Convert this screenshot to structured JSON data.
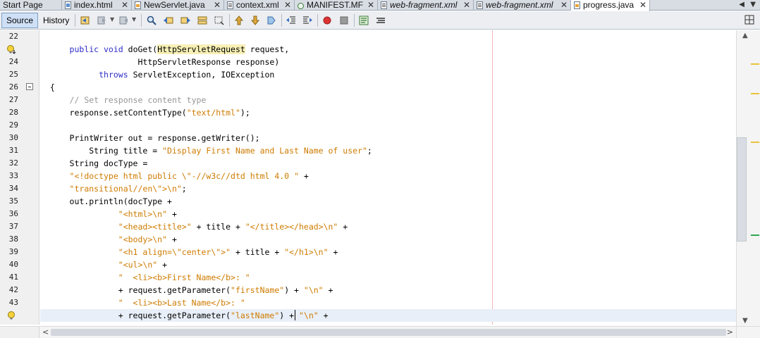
{
  "tabs": [
    {
      "label": "Start Page",
      "icon": "start-page-icon",
      "italic": false,
      "active": false,
      "closable": false
    },
    {
      "label": "index.html",
      "icon": "html-file-icon",
      "italic": false,
      "active": false,
      "closable": true
    },
    {
      "label": "NewServlet.java",
      "icon": "java-file-icon",
      "italic": false,
      "active": false,
      "closable": true
    },
    {
      "label": "context.xml",
      "icon": "xml-file-icon",
      "italic": false,
      "active": false,
      "closable": true
    },
    {
      "label": "MANIFEST.MF",
      "icon": "manifest-file-icon",
      "italic": false,
      "active": false,
      "closable": true
    },
    {
      "label": "web-fragment.xml",
      "icon": "xml-file-icon",
      "italic": true,
      "active": false,
      "closable": true
    },
    {
      "label": "web-fragment.xml",
      "icon": "xml-file-icon",
      "italic": true,
      "active": false,
      "closable": true
    },
    {
      "label": "progress.java",
      "icon": "java-file-icon",
      "italic": false,
      "active": true,
      "closable": true
    }
  ],
  "toolbar": {
    "source_label": "Source",
    "history_label": "History",
    "active_mode": "Source"
  },
  "editor": {
    "current_line": 44,
    "lines": [
      {
        "no": 22,
        "tokens": [
          {
            "t": ""
          }
        ]
      },
      {
        "no": 23,
        "tokens": [
          {
            "t": "      "
          },
          {
            "t": "public void",
            "c": "kw"
          },
          {
            "t": " doGet("
          },
          {
            "t": "HttpServletRequest",
            "c": "hl"
          },
          {
            "t": " request,"
          }
        ]
      },
      {
        "no": 24,
        "tokens": [
          {
            "t": "                    HttpServletResponse response)"
          }
        ]
      },
      {
        "no": 25,
        "tokens": [
          {
            "t": "            "
          },
          {
            "t": "throws",
            "c": "kw"
          },
          {
            "t": " ServletException, IOException"
          }
        ]
      },
      {
        "no": 26,
        "tokens": [
          {
            "t": "  {"
          }
        ]
      },
      {
        "no": 27,
        "tokens": [
          {
            "t": "      "
          },
          {
            "t": "// Set response content type",
            "c": "cmt"
          }
        ]
      },
      {
        "no": 28,
        "tokens": [
          {
            "t": "      response.setContentType("
          },
          {
            "t": "\"text/html\"",
            "c": "str"
          },
          {
            "t": ");"
          }
        ]
      },
      {
        "no": 29,
        "tokens": [
          {
            "t": ""
          }
        ]
      },
      {
        "no": 30,
        "tokens": [
          {
            "t": "      PrintWriter out = response.getWriter();"
          }
        ]
      },
      {
        "no": 31,
        "tokens": [
          {
            "t": "          String title = "
          },
          {
            "t": "\"Display First Name and Last Name of user\"",
            "c": "str"
          },
          {
            "t": ";"
          }
        ]
      },
      {
        "no": 32,
        "tokens": [
          {
            "t": "      String docType ="
          }
        ]
      },
      {
        "no": 33,
        "tokens": [
          {
            "t": "      "
          },
          {
            "t": "\"<!doctype html public \\\"-//w3c//dtd html 4.0 \"",
            "c": "str"
          },
          {
            "t": " +"
          }
        ]
      },
      {
        "no": 34,
        "tokens": [
          {
            "t": "      "
          },
          {
            "t": "\"transitional//en\\\">\\n\"",
            "c": "str"
          },
          {
            "t": ";"
          }
        ]
      },
      {
        "no": 35,
        "tokens": [
          {
            "t": "      out.println(docType +"
          }
        ]
      },
      {
        "no": 36,
        "tokens": [
          {
            "t": "                "
          },
          {
            "t": "\"<html>\\n\"",
            "c": "str"
          },
          {
            "t": " +"
          }
        ]
      },
      {
        "no": 37,
        "tokens": [
          {
            "t": "                "
          },
          {
            "t": "\"<head><title>\"",
            "c": "str"
          },
          {
            "t": " + title + "
          },
          {
            "t": "\"</title></head>\\n\"",
            "c": "str"
          },
          {
            "t": " +"
          }
        ]
      },
      {
        "no": 38,
        "tokens": [
          {
            "t": "                "
          },
          {
            "t": "\"<body>\\n\"",
            "c": "str"
          },
          {
            "t": " +"
          }
        ]
      },
      {
        "no": 39,
        "tokens": [
          {
            "t": "                "
          },
          {
            "t": "\"<h1 align=\\\"center\\\">\"",
            "c": "str"
          },
          {
            "t": " + title + "
          },
          {
            "t": "\"</h1>\\n\"",
            "c": "str"
          },
          {
            "t": " +"
          }
        ]
      },
      {
        "no": 40,
        "tokens": [
          {
            "t": "                "
          },
          {
            "t": "\"<ul>\\n\"",
            "c": "str"
          },
          {
            "t": " +"
          }
        ]
      },
      {
        "no": 41,
        "tokens": [
          {
            "t": "                "
          },
          {
            "t": "\"  <li><b>First Name</b>: \"",
            "c": "str"
          }
        ]
      },
      {
        "no": 42,
        "tokens": [
          {
            "t": "                + request.getParameter("
          },
          {
            "t": "\"firstName\"",
            "c": "str"
          },
          {
            "t": ") + "
          },
          {
            "t": "\"\\n\"",
            "c": "str"
          },
          {
            "t": " +"
          }
        ]
      },
      {
        "no": 43,
        "tokens": [
          {
            "t": "                "
          },
          {
            "t": "\"  <li><b>Last Name</b>: \"",
            "c": "str"
          }
        ]
      },
      {
        "no": 44,
        "tokens": [
          {
            "t": "                + request.getParameter("
          },
          {
            "t": "\"lastName\"",
            "c": "str"
          },
          {
            "t": ") + "
          },
          {
            "t": "\"\\n\"",
            "c": "str"
          },
          {
            "t": " +"
          }
        ]
      }
    ]
  },
  "colors": {
    "keyword": "#2d2dc8",
    "string": "#ce7b00",
    "comment": "#969696",
    "current_line": "#e9eff8",
    "right_margin": "#f2b4b4"
  }
}
